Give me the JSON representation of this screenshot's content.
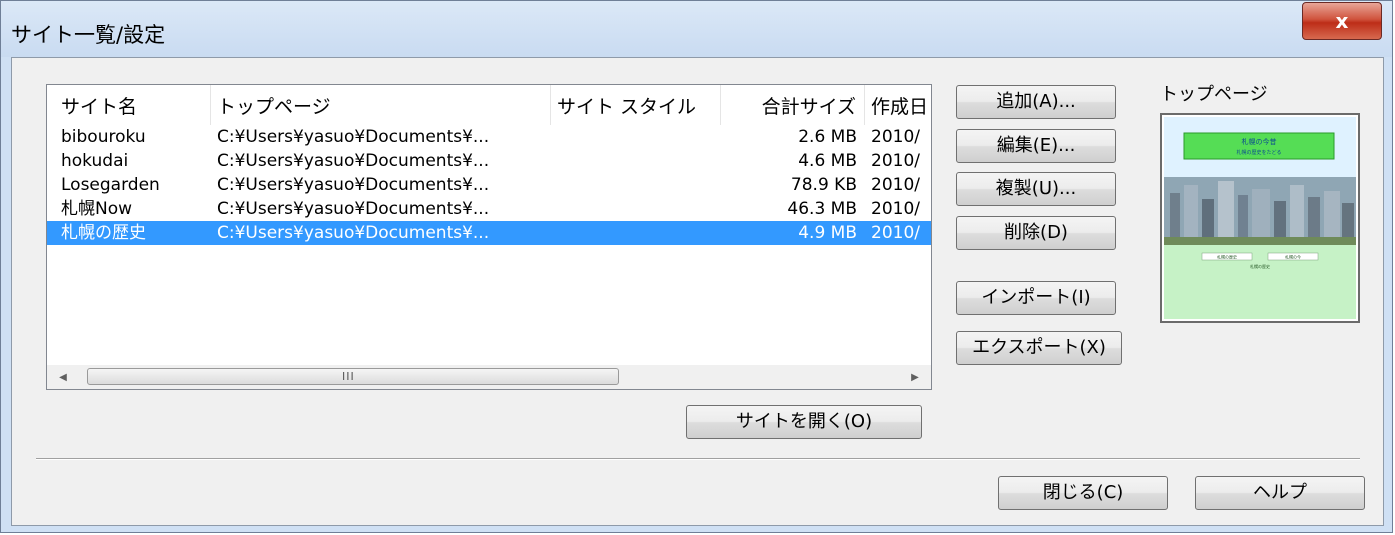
{
  "window": {
    "title": "サイト一覧/設定",
    "close_glyph": "x"
  },
  "list": {
    "columns": [
      "サイト名",
      "トップページ",
      "サイト スタイル",
      "合計サイズ",
      "作成日"
    ],
    "rows": [
      {
        "name": "bibouroku",
        "top": "C:¥Users¥yasuo¥Documents¥...",
        "style": "",
        "size": "2.6 MB",
        "date": "2010/"
      },
      {
        "name": "hokudai",
        "top": "C:¥Users¥yasuo¥Documents¥...",
        "style": "",
        "size": "4.6 MB",
        "date": "2010/"
      },
      {
        "name": "Losegarden",
        "top": "C:¥Users¥yasuo¥Documents¥...",
        "style": "",
        "size": "78.9 KB",
        "date": "2010/"
      },
      {
        "name": "札幌Now",
        "top": "C:¥Users¥yasuo¥Documents¥...",
        "style": "",
        "size": "46.3 MB",
        "date": "2010/"
      },
      {
        "name": "札幌の歴史",
        "top": "C:¥Users¥yasuo¥Documents¥...",
        "style": "",
        "size": "4.9 MB",
        "date": "2010/"
      }
    ],
    "selected_index": 4,
    "scroll": {
      "left_arrow": "◀",
      "right_arrow": "▶",
      "grip": "III"
    }
  },
  "buttons": {
    "add": "追加(A)...",
    "edit": "編集(E)...",
    "duplicate": "複製(U)...",
    "delete": "削除(D)",
    "import": "インポート(I)",
    "export": "エクスポート(X)",
    "open_site": "サイトを開く(O)",
    "close": "閉じる(C)",
    "help": "ヘルプ"
  },
  "preview": {
    "label": "トップページ",
    "thumbnail": {
      "title": "札幌の今昔",
      "subtitle": "札幌の歴史をたどる",
      "links": [
        "札幌の歴史",
        "札幌の今"
      ],
      "footer": "札幌の歴史"
    }
  },
  "colors": {
    "selection": "#3399ff",
    "title_bg": "#cfe0f4",
    "close_red": "#c9462c"
  }
}
